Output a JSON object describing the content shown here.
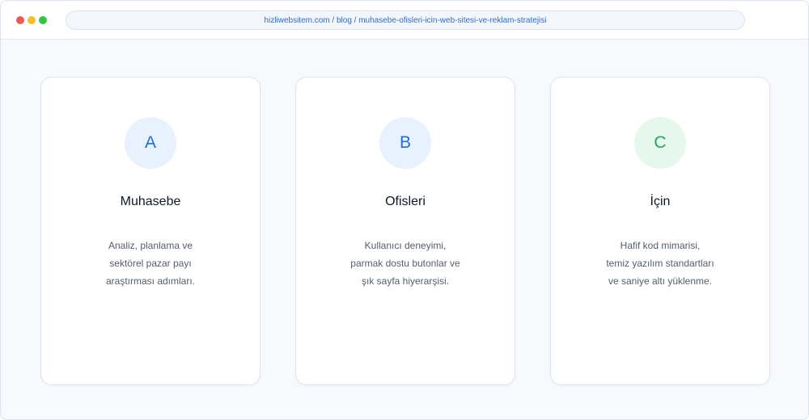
{
  "browser": {
    "url": "hizliwebsitem.com / blog / muhasebe-ofisleri-icin-web-sitesi-ve-reklam-stratejisi"
  },
  "colors": {
    "accent_blue": "#1f6fe0",
    "accent_green": "#1faa55",
    "badge_blue_bg": "#e8f1fe",
    "badge_green_bg": "#e6f8ee"
  },
  "cards": [
    {
      "letter": "A",
      "title": "Muhasebe",
      "lines": [
        "Analiz, planlama ve",
        "sektörel pazar payı",
        "araştırması adımları."
      ]
    },
    {
      "letter": "B",
      "title": "Ofisleri",
      "lines": [
        "Kullanıcı deneyimi,",
        "parmak dostu butonlar ve",
        "şık sayfa hiyerarşisi."
      ]
    },
    {
      "letter": "C",
      "title": "İçin",
      "lines": [
        "Hafif kod mimarisi,",
        "temiz yazılım standartları",
        "ve saniye altı yüklenme."
      ]
    }
  ]
}
